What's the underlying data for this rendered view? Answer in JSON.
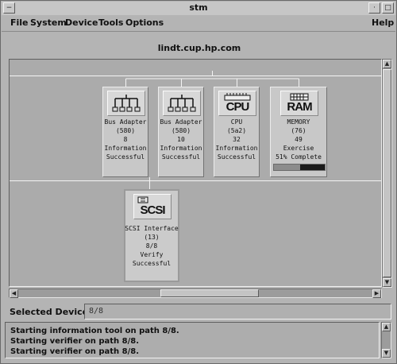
{
  "window": {
    "title": "stm"
  },
  "menubar": {
    "items": [
      "File",
      "System",
      "Device",
      "Tools",
      "Options"
    ],
    "help": "Help"
  },
  "host": "lindt.cup.hp.com",
  "devices": [
    {
      "icon": "bus-adapter-icon",
      "lines": [
        "Bus Adapter",
        "(580)",
        "8",
        "Information",
        "Successful"
      ]
    },
    {
      "icon": "bus-adapter-icon",
      "lines": [
        "Bus Adapter",
        "(580)",
        "10",
        "Information",
        "Successful"
      ]
    },
    {
      "icon": "cpu-icon",
      "icon_text": "CPU",
      "lines": [
        "CPU",
        "(5a2)",
        "32",
        "Information",
        "Successful"
      ]
    },
    {
      "icon": "ram-icon",
      "icon_text": "RAM",
      "lines": [
        "MEMORY",
        "(76)",
        "49",
        "Exercise",
        "51% Complete"
      ],
      "progress": 0.51
    },
    {
      "icon": "scsi-icon",
      "icon_text": "SCSI",
      "lines": [
        "SCSI Interface",
        "(13)",
        "8/8",
        "Verify",
        "Successful"
      ]
    }
  ],
  "selected_devices": {
    "label": "Selected Devices:",
    "value": "8/8"
  },
  "log": [
    "Starting information tool on path 8/8.",
    "Starting verifier on path 8/8.",
    "Starting verifier on path 8/8."
  ],
  "colors": {
    "window_bg": "#b4b4b4",
    "canvas_bg": "#ababab",
    "progress_done": "#8c8c8c",
    "progress_remaining": "#1b1b1b"
  }
}
